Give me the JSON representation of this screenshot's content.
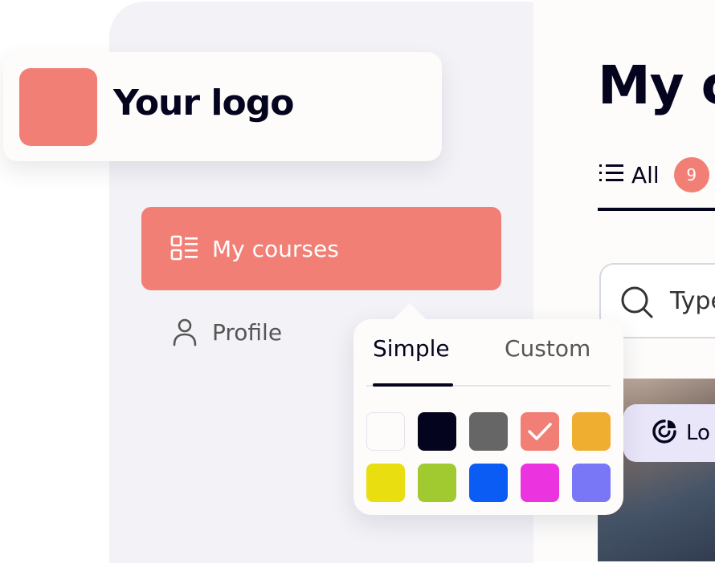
{
  "logo": {
    "text": "Your logo",
    "color": "#f17f76"
  },
  "nav": {
    "items": [
      {
        "label": "My courses",
        "icon": "list-grid-icon",
        "active": true
      },
      {
        "label": "Profile",
        "icon": "user-icon",
        "active": false
      }
    ]
  },
  "main": {
    "title": "My c",
    "tabs": [
      {
        "label": "All",
        "icon": "list-icon",
        "count": "9"
      }
    ],
    "search": {
      "placeholder": "Type"
    },
    "card_chip": {
      "label": "Lo",
      "icon": "progress-chart-icon"
    }
  },
  "color_picker": {
    "tabs": [
      "Simple",
      "Custom"
    ],
    "active_tab": "Simple",
    "swatches": [
      {
        "color": "#fdfcfb",
        "selected": false
      },
      {
        "color": "#05041f",
        "selected": false
      },
      {
        "color": "#666666",
        "selected": false
      },
      {
        "color": "#f17f76",
        "selected": true
      },
      {
        "color": "#efae2f",
        "selected": false
      },
      {
        "color": "#e8de10",
        "selected": false
      },
      {
        "color": "#a1c930",
        "selected": false
      },
      {
        "color": "#0a5cf5",
        "selected": false
      },
      {
        "color": "#ec33e0",
        "selected": false
      },
      {
        "color": "#7977f5",
        "selected": false
      }
    ]
  },
  "colors": {
    "accent": "#f17f76",
    "text": "#05041f",
    "sidebar_bg": "#f2f2f7"
  }
}
